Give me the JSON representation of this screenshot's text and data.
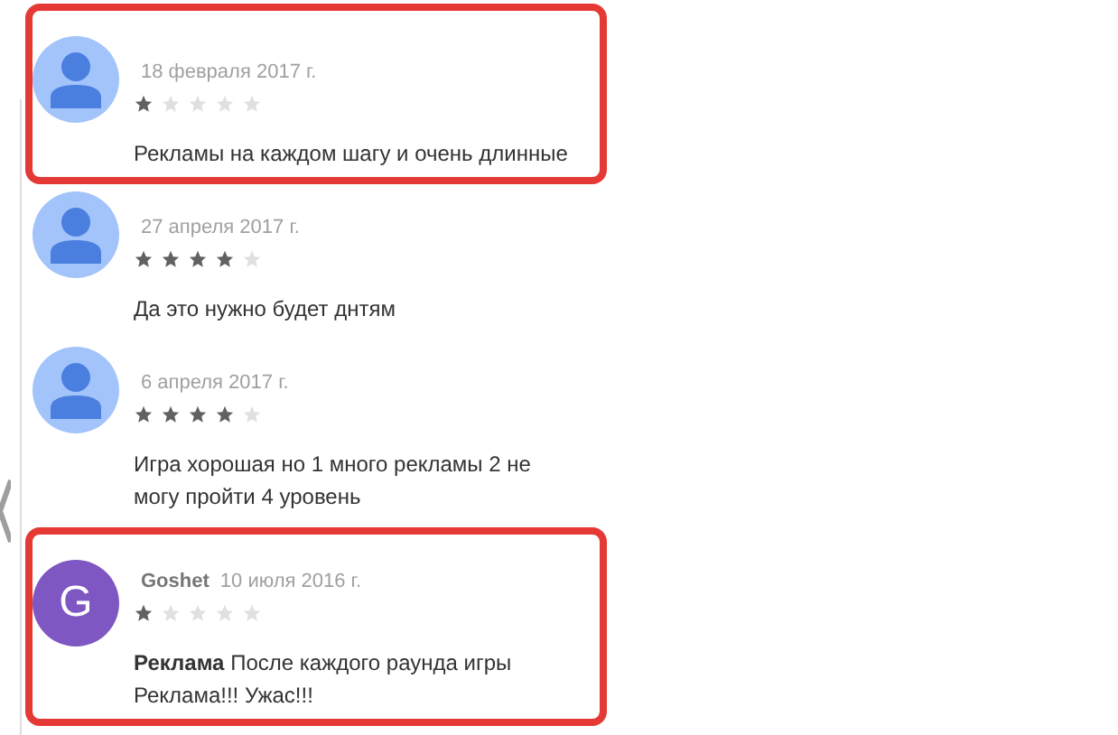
{
  "reviews": [
    {
      "highlighted": true,
      "avatar": {
        "kind": "silhouette"
      },
      "date": "18 февраля 2017 г.",
      "stars": 1,
      "text": "Рекламы на каждом шагу и очень длинные"
    },
    {
      "highlighted": false,
      "avatar": {
        "kind": "silhouette"
      },
      "date": "27 апреля 2017 г.",
      "stars": 4,
      "text": "Да это нужно будет днтям"
    },
    {
      "highlighted": false,
      "avatar": {
        "kind": "silhouette"
      },
      "date": "6 апреля 2017 г.",
      "stars": 4,
      "text": "Игра хорошая но 1 много рекламы 2 не могу пройти 4 уровень"
    },
    {
      "highlighted": true,
      "avatar": {
        "kind": "letter",
        "letter": "G",
        "color": "#7e57c2"
      },
      "author": "Goshet",
      "date": "10 июля 2016 г.",
      "stars": 1,
      "text": "**Реклама** После каждого раунда игры Реклама!!! Ужас!!!"
    }
  ]
}
